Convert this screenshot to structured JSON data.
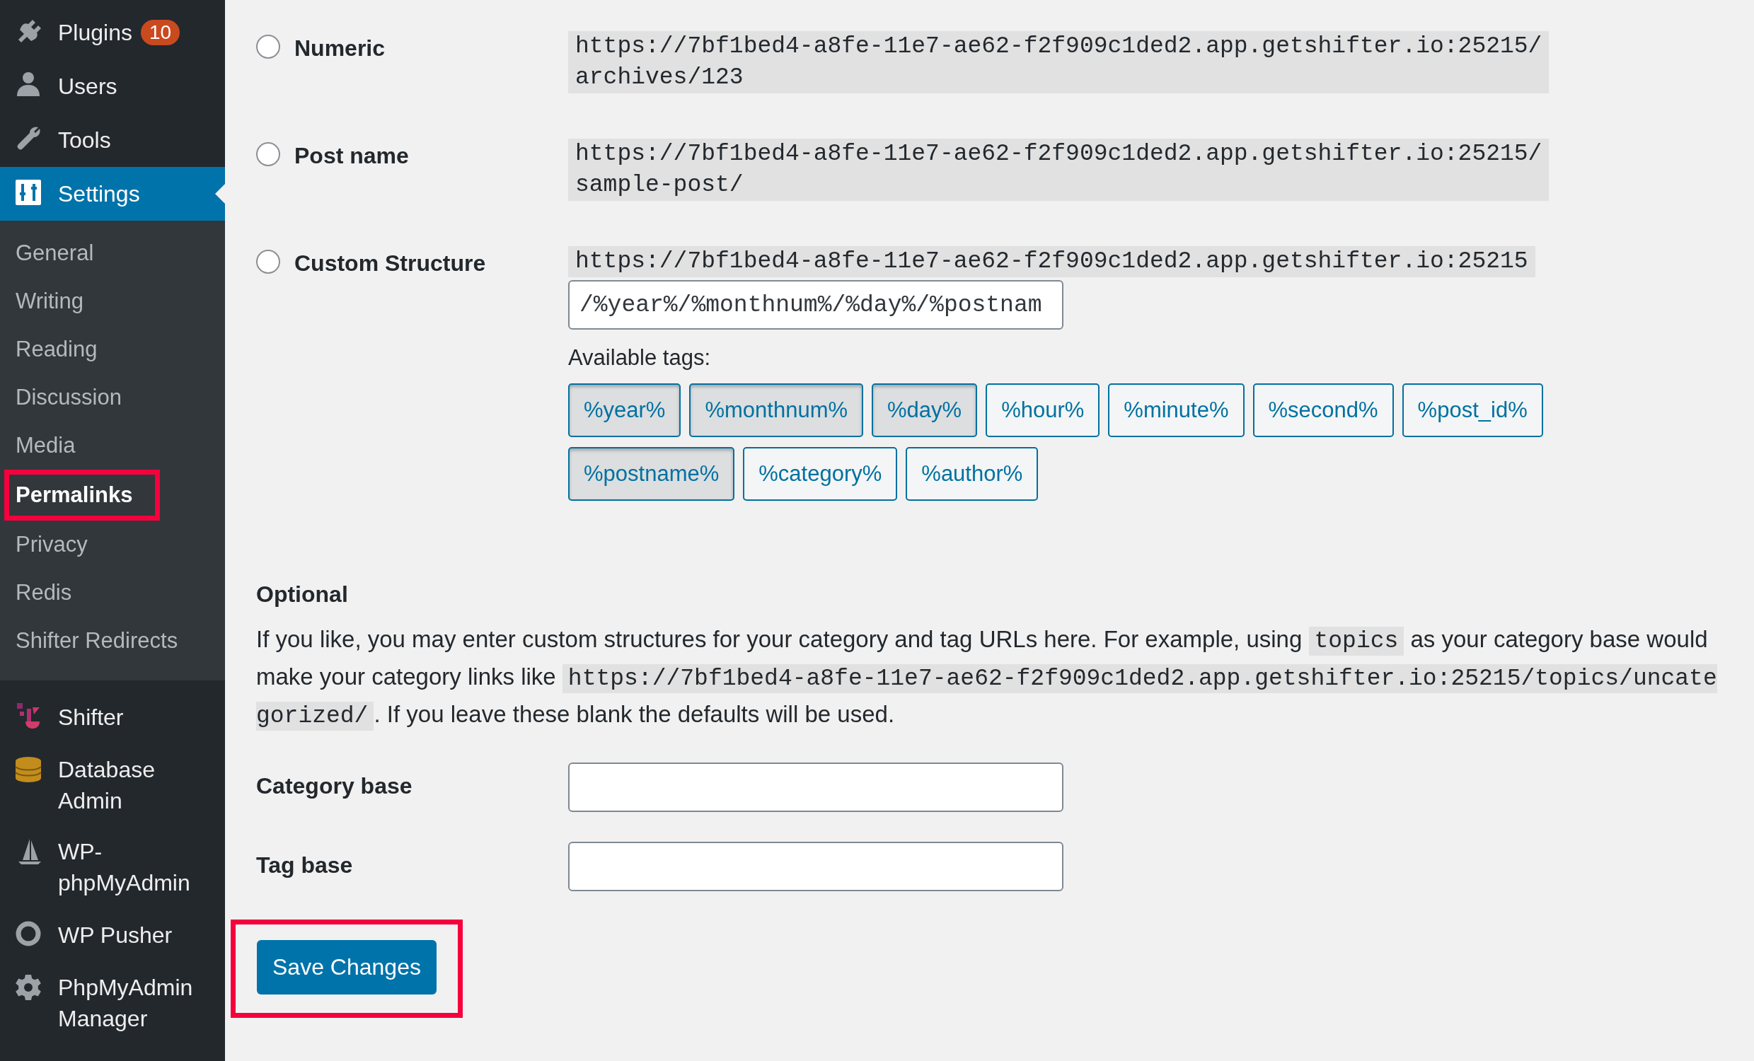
{
  "sidebar": {
    "menu": [
      {
        "label": "Plugins",
        "badge": "10",
        "selected": false
      },
      {
        "label": "Users",
        "selected": false
      },
      {
        "label": "Tools",
        "selected": false
      },
      {
        "label": "Settings",
        "selected": true,
        "submenu": [
          {
            "label": "General",
            "selected": false,
            "highlighted": false
          },
          {
            "label": "Writing",
            "selected": false,
            "highlighted": false
          },
          {
            "label": "Reading",
            "selected": false,
            "highlighted": false
          },
          {
            "label": "Discussion",
            "selected": false,
            "highlighted": false
          },
          {
            "label": "Media",
            "selected": false,
            "highlighted": false
          },
          {
            "label": "Permalinks",
            "selected": true,
            "highlighted": true
          },
          {
            "label": "Privacy",
            "selected": false,
            "highlighted": false
          },
          {
            "label": "Redis",
            "selected": false,
            "highlighted": false
          },
          {
            "label": "Shifter Redirects",
            "selected": false,
            "highlighted": false
          }
        ]
      },
      {
        "label": "Shifter",
        "selected": false
      },
      {
        "label": "Database Admin",
        "selected": false
      },
      {
        "label": "WP-phpMyAdmin",
        "selected": false
      },
      {
        "label": "WP Pusher",
        "selected": false
      },
      {
        "label": "PhpMyAdmin Manager",
        "selected": false
      }
    ]
  },
  "permalink_options": [
    {
      "label": "Numeric",
      "selected": false,
      "example": "https://7bf1bed4-a8fe-11e7-ae62-f2f909c1ded2.app.getshifter.io:25215/archives/123"
    },
    {
      "label": "Post name",
      "selected": false,
      "example": "https://7bf1bed4-a8fe-11e7-ae62-f2f909c1ded2.app.getshifter.io:25215/sample-post/"
    },
    {
      "label": "Custom Structure",
      "selected": false,
      "example": "https://7bf1bed4-a8fe-11e7-ae62-f2f909c1ded2.app.getshifter.io:25215",
      "value": "/%year%/%monthnum%/%day%/%postnam"
    }
  ],
  "available_tags": {
    "label": "Available tags:",
    "tags": [
      {
        "label": "%year%",
        "selected": true
      },
      {
        "label": "%monthnum%",
        "selected": true
      },
      {
        "label": "%day%",
        "selected": true
      },
      {
        "label": "%hour%",
        "selected": false
      },
      {
        "label": "%minute%",
        "selected": false
      },
      {
        "label": "%second%",
        "selected": false
      },
      {
        "label": "%post_id%",
        "selected": false
      },
      {
        "label": "%postname%",
        "selected": true
      },
      {
        "label": "%category%",
        "selected": false
      },
      {
        "label": "%author%",
        "selected": false
      }
    ]
  },
  "optional": {
    "heading": "Optional",
    "description": [
      {
        "kind": "text",
        "text": "If you like, you may enter custom structures for your category and tag URLs here. For example, using "
      },
      {
        "kind": "code",
        "text": "topics"
      },
      {
        "kind": "text",
        "text": " as your category base would make your category links like "
      },
      {
        "kind": "code",
        "text": "https://7bf1bed4-a8fe-11e7-ae62-f2f909c1ded2.app.getshifter.io:25215/topics/uncategorized/"
      },
      {
        "kind": "text",
        "text": ". If you leave these blank the defaults will be used."
      }
    ]
  },
  "fields": [
    {
      "label": "Category base"
    },
    {
      "label": "Tag base"
    }
  ],
  "save_button": {
    "label": "Save Changes",
    "highlighted": true
  }
}
